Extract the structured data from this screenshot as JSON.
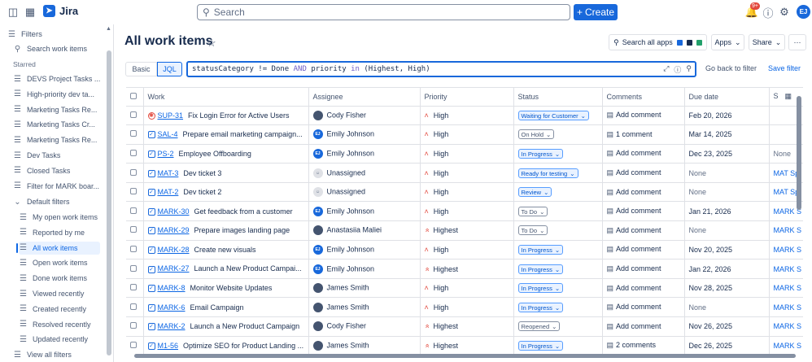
{
  "topbar": {
    "app_name": "Jira",
    "search_placeholder": "Search",
    "create_label": "Create",
    "notif_badge": "9+",
    "avatar_initials": "EJ"
  },
  "sidebar": {
    "filters_label": "Filters",
    "search_label": "Search work items",
    "starred_label": "Starred",
    "starred": [
      "DEVS Project Tasks ...",
      "High-priority dev ta...",
      "Marketing Tasks Re...",
      "Marketing Tasks Cr...",
      "Marketing Tasks Re...",
      "Dev Tasks",
      "Closed Tasks",
      "Filter for MARK boar..."
    ],
    "default_filters_label": "Default filters",
    "default_filters": [
      "My open work items",
      "Reported by me",
      "All work items",
      "Open work items",
      "Done work items",
      "Viewed recently",
      "Created recently",
      "Resolved recently",
      "Updated recently"
    ],
    "view_all_label": "View all filters"
  },
  "header": {
    "title": "All work items",
    "search_apps_label": "Search all apps",
    "apps_label": "Apps",
    "share_label": "Share",
    "more_label": "···"
  },
  "query": {
    "basic_label": "Basic",
    "jql_label": "JQL",
    "jql_parts": [
      "statusCategory",
      " != Done ",
      "AND",
      " priority ",
      "in",
      " (Highest, High)"
    ],
    "go_back_label": "Go back to filter",
    "save_label": "Save filter"
  },
  "table": {
    "columns": [
      "Work",
      "Assignee",
      "Priority",
      "Status",
      "Comments",
      "Due date",
      "S"
    ],
    "rows": [
      {
        "type": "bug",
        "key": "SUP-31",
        "summary": "Fix Login Error for Active Users",
        "assignee": "Cody Fisher",
        "avatar": "photo",
        "priority": "High",
        "status": "Waiting for Customer",
        "status_style": "blue",
        "comments": "Add comment",
        "due": "Feb 20, 2026",
        "sprint": ""
      },
      {
        "type": "task",
        "key": "SAL-4",
        "summary": "Prepare email marketing campaign...",
        "assignee": "Emily Johnson",
        "avatar": "EJ",
        "priority": "High",
        "status": "On Hold",
        "status_style": "gray",
        "comments": "1 comment",
        "due": "Mar 14, 2025",
        "sprint": ""
      },
      {
        "type": "task",
        "key": "PS-2",
        "summary": "Employee Offboarding",
        "assignee": "Emily Johnson",
        "avatar": "EJ",
        "priority": "High",
        "status": "In Progress",
        "status_style": "blue",
        "comments": "Add comment",
        "due": "Dec 23, 2025",
        "sprint": "None"
      },
      {
        "type": "task",
        "key": "MAT-3",
        "summary": "Dev ticket 3",
        "assignee": "Unassigned",
        "avatar": "none",
        "priority": "High",
        "status": "Ready for testing",
        "status_style": "blue",
        "comments": "Add comment",
        "due": "None",
        "sprint": "MAT Sp"
      },
      {
        "type": "task",
        "key": "MAT-2",
        "summary": "Dev ticket 2",
        "assignee": "Unassigned",
        "avatar": "none",
        "priority": "High",
        "status": "Review",
        "status_style": "blue",
        "comments": "Add comment",
        "due": "None",
        "sprint": "MAT Sp"
      },
      {
        "type": "task",
        "key": "MARK-30",
        "summary": "Get feedback from a customer",
        "assignee": "Emily Johnson",
        "avatar": "EJ",
        "priority": "High",
        "status": "To Do",
        "status_style": "gray",
        "comments": "Add comment",
        "due": "Jan 21, 2026",
        "sprint": "MARK S"
      },
      {
        "type": "task",
        "key": "MARK-29",
        "summary": "Prepare images landing page",
        "assignee": "Anastasiia Maliei",
        "avatar": "photo",
        "priority": "Highest",
        "status": "To Do",
        "status_style": "gray",
        "comments": "Add comment",
        "due": "None",
        "sprint": "MARK S"
      },
      {
        "type": "task",
        "key": "MARK-28",
        "summary": "Create new visuals",
        "assignee": "Emily Johnson",
        "avatar": "EJ",
        "priority": "High",
        "status": "In Progress",
        "status_style": "blue",
        "comments": "Add comment",
        "due": "Nov 20, 2025",
        "sprint": "MARK S"
      },
      {
        "type": "task",
        "key": "MARK-27",
        "summary": "Launch a New Product Campai...",
        "assignee": "Emily Johnson",
        "avatar": "EJ",
        "priority": "Highest",
        "status": "In Progress",
        "status_style": "blue",
        "comments": "Add comment",
        "due": "Jan 22, 2026",
        "sprint": "MARK S"
      },
      {
        "type": "task",
        "key": "MARK-8",
        "summary": "Monitor Website Updates",
        "assignee": "James Smith",
        "avatar": "photo",
        "priority": "High",
        "status": "In Progress",
        "status_style": "blue",
        "comments": "Add comment",
        "due": "Nov 28, 2025",
        "sprint": "MARK S"
      },
      {
        "type": "task",
        "key": "MARK-6",
        "summary": "Email Campaign",
        "assignee": "James Smith",
        "avatar": "photo",
        "priority": "High",
        "status": "In Progress",
        "status_style": "blue",
        "comments": "Add comment",
        "due": "None",
        "sprint": "MARK S"
      },
      {
        "type": "task",
        "key": "MARK-2",
        "summary": "Launch a New Product Campaign",
        "assignee": "Cody Fisher",
        "avatar": "photo",
        "priority": "Highest",
        "status": "Reopened",
        "status_style": "gray",
        "comments": "Add comment",
        "due": "Nov 26, 2025",
        "sprint": "MARK S"
      },
      {
        "type": "task",
        "key": "M1-56",
        "summary": "Optimize SEO for Product Landing ...",
        "assignee": "James Smith",
        "avatar": "photo",
        "priority": "Highest",
        "status": "In Progress",
        "status_style": "blue",
        "comments": "2 comments",
        "due": "Dec 26, 2025",
        "sprint": "MARK S"
      }
    ]
  }
}
